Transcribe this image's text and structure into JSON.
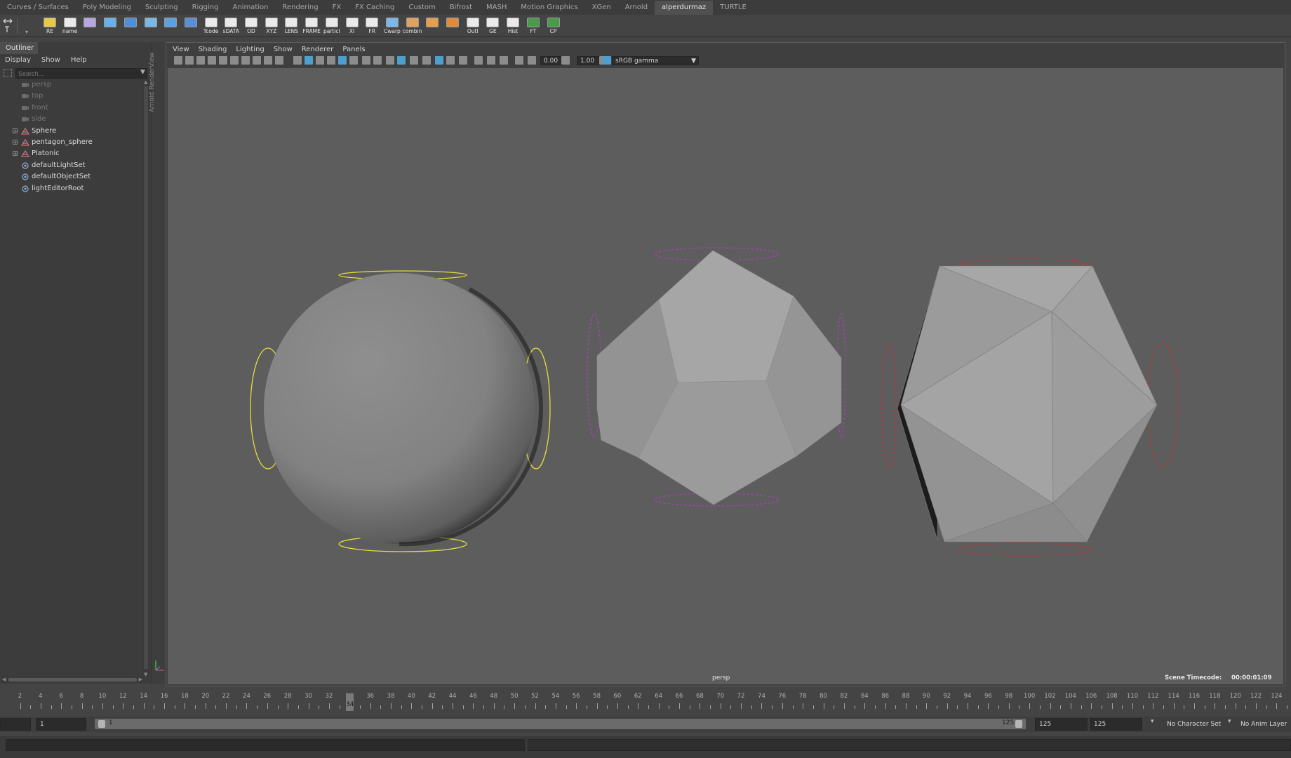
{
  "shelf": {
    "tabs": [
      "Curves / Surfaces",
      "Poly Modeling",
      "Sculpting",
      "Rigging",
      "Animation",
      "Rendering",
      "FX",
      "FX Caching",
      "Custom",
      "Bifrost",
      "MASH",
      "Motion Graphics",
      "XGen",
      "Arnold",
      "alperdurmaz",
      "TURTLE"
    ],
    "active_tab": "alperdurmaz",
    "buttons": [
      "RE",
      "name",
      "",
      "",
      "",
      "",
      "",
      "",
      "Tcode",
      "sDATA",
      "OD",
      "XYZ",
      "LENS",
      "FRAME",
      "particl",
      "XI",
      "FR",
      "Cwarp",
      "combin",
      "",
      "",
      "Outl",
      "GE",
      "Hist",
      "FT",
      "CP"
    ]
  },
  "outliner": {
    "title": "Outliner",
    "menu": [
      "Display",
      "Show",
      "Help"
    ],
    "search_placeholder": "Search...",
    "items": [
      {
        "label": "persp",
        "kind": "camera"
      },
      {
        "label": "top",
        "kind": "camera"
      },
      {
        "label": "front",
        "kind": "camera"
      },
      {
        "label": "side",
        "kind": "camera"
      },
      {
        "label": "Sphere",
        "kind": "group"
      },
      {
        "label": "pentagon_sphere",
        "kind": "group"
      },
      {
        "label": "Platonic",
        "kind": "group"
      },
      {
        "label": "defaultLightSet",
        "kind": "set"
      },
      {
        "label": "defaultObjectSet",
        "kind": "set"
      },
      {
        "label": "lightEditorRoot",
        "kind": "set"
      }
    ]
  },
  "side_panel_label": "Arnold RenderView",
  "viewport": {
    "menu": [
      "View",
      "Shading",
      "Lighting",
      "Show",
      "Renderer",
      "Panels"
    ],
    "exposure": "0.00",
    "gamma": "1.00",
    "color_space": "sRGB gamma",
    "camera_label": "persp",
    "timecode_label": "Scene Timecode:",
    "timecode_value": "00:00:01:09"
  },
  "timeline": {
    "ticks": [
      "2",
      "4",
      "6",
      "8",
      "10",
      "12",
      "14",
      "16",
      "18",
      "20",
      "22",
      "24",
      "26",
      "28",
      "30",
      "32",
      "34",
      "36",
      "38",
      "40",
      "42",
      "44",
      "46",
      "48",
      "50",
      "52",
      "54",
      "56",
      "58",
      "60",
      "62",
      "64",
      "66",
      "68",
      "70",
      "72",
      "74",
      "76",
      "78",
      "80",
      "82",
      "84",
      "86",
      "88",
      "90",
      "92",
      "94",
      "96",
      "98",
      "100",
      "102",
      "104",
      "106",
      "108",
      "110",
      "112",
      "114",
      "116",
      "118",
      "120",
      "122",
      "124"
    ],
    "current_frame": "34"
  },
  "range": {
    "start": "1",
    "slider_start": "1",
    "slider_end": "125",
    "end": "125",
    "anim_end": "125",
    "character_set": "No Character Set",
    "anim_layer": "No Anim Layer"
  },
  "colors": {
    "viewport_bg": "#5d5d5d",
    "sphere_handles": "#e6dc3c",
    "pentagon_handles": "#b03cc0",
    "platonic_handles": "#c83232",
    "accent": "#4d9fd0"
  }
}
